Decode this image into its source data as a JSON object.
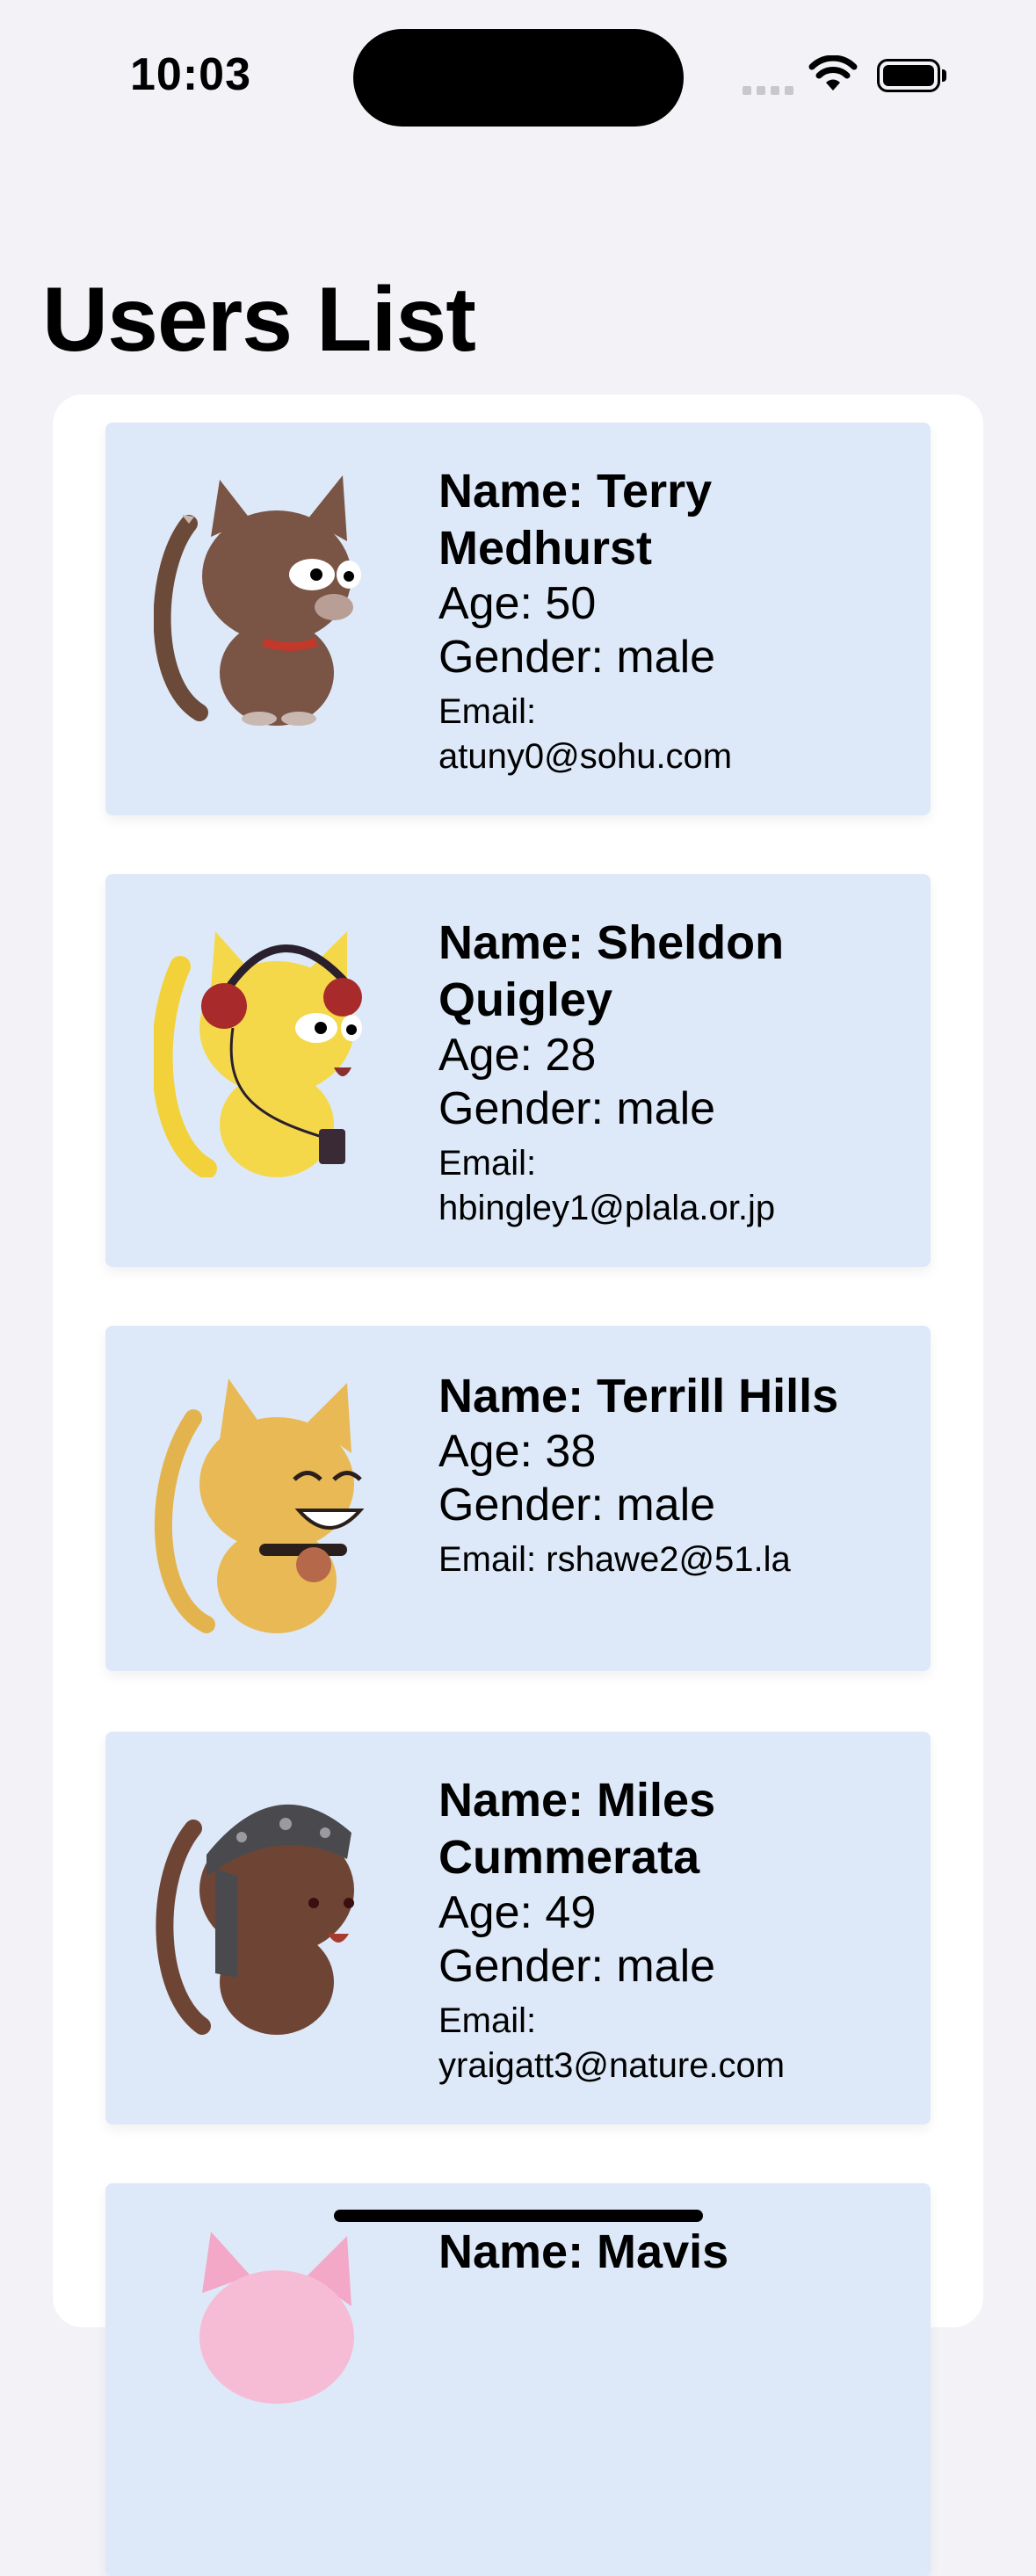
{
  "status_bar": {
    "time": "10:03"
  },
  "page": {
    "title": "Users List"
  },
  "users": [
    {
      "name_label": "Name: Terry",
      "name_label2": "Medhurst",
      "age_label": "Age: 50",
      "gender_label": "Gender: male",
      "email_label": "Email:",
      "email_value": "atuny0@sohu.com",
      "avatar": "brown-cat-avatar"
    },
    {
      "name_label": "Name: Sheldon",
      "name_label2": "Quigley",
      "age_label": "Age: 28",
      "gender_label": "Gender: male",
      "email_label": "Email:",
      "email_value": "hbingley1@plala.or.jp",
      "avatar": "yellow-cat-headphones-avatar"
    },
    {
      "name_label": "Name: Terrill Hills",
      "age_label": "Age: 38",
      "gender_label": "Gender: male",
      "email_line": "Email: rshawe2@51.la",
      "avatar": "golden-cat-avatar"
    },
    {
      "name_label": "Name: Miles",
      "name_label2": "Cummerata",
      "age_label": "Age: 49",
      "gender_label": "Gender: male",
      "email_label": "Email:",
      "email_value": "yraigatt3@nature.com",
      "avatar": "brown-cat-bandana-avatar"
    },
    {
      "name_label": "Name: Mavis",
      "avatar": "pink-cat-avatar"
    }
  ]
}
